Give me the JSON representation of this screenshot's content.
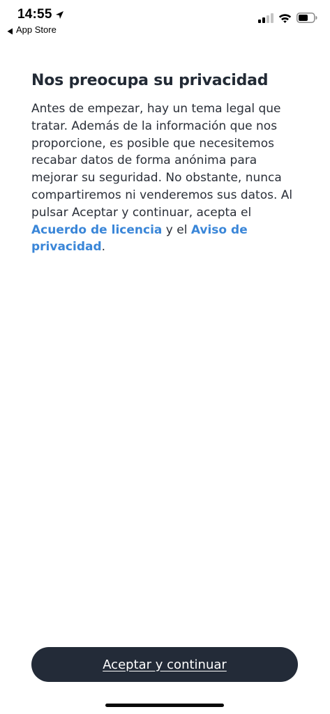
{
  "status_bar": {
    "time": "14:55",
    "back_label": "App Store",
    "icons": [
      "location-arrow-icon",
      "signal-icon",
      "wifi-icon",
      "battery-icon"
    ]
  },
  "privacy": {
    "title": "Nos preocupa su privacidad",
    "body_intro": "Antes de empezar, hay un tema legal que tratar. Además de la información que nos proporcione, es posible que necesitemos recabar datos de forma anónima para mejorar su seguridad. No obstante, nunca compartiremos ni venderemos sus datos. Al pulsar Aceptar y continuar, acepta el ",
    "license_link": "Acuerdo de licencia",
    "connector": " y el ",
    "privacy_link": "Aviso de privacidad",
    "end": "."
  },
  "actions": {
    "accept_label": "Aceptar y continuar"
  },
  "colors": {
    "text": "#222a35",
    "link": "#3a86d8",
    "button_bg": "#232b38",
    "button_text": "#ffffff"
  }
}
